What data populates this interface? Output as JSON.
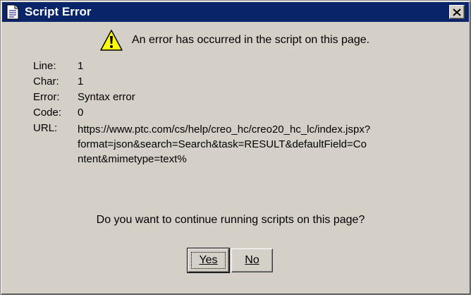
{
  "window": {
    "title": "Script Error",
    "title_icon": "document-icon",
    "close_icon": "close-icon",
    "titlebar_color": "#0a246a",
    "background_color": "#d4d0c8"
  },
  "message": {
    "icon": "warning-icon",
    "text": "An error has occurred in the script on this page."
  },
  "details": {
    "line_label": "Line:",
    "line_value": "1",
    "char_label": "Char:",
    "char_value": "1",
    "error_label": "Error:",
    "error_value": "Syntax error",
    "code_label": "Code:",
    "code_value": "0",
    "url_label": "URL:",
    "url_lines": [
      "https://www.ptc.com/cs/help/creo_hc/creo20_hc_lc/index.jspx?",
      "format=json&search=Search&task=RESULT&defaultField=Co",
      "ntent&mimetype=text%"
    ]
  },
  "question": "Do you want to continue running scripts on this page?",
  "buttons": {
    "yes_label": "Yes",
    "no_label": "No"
  }
}
